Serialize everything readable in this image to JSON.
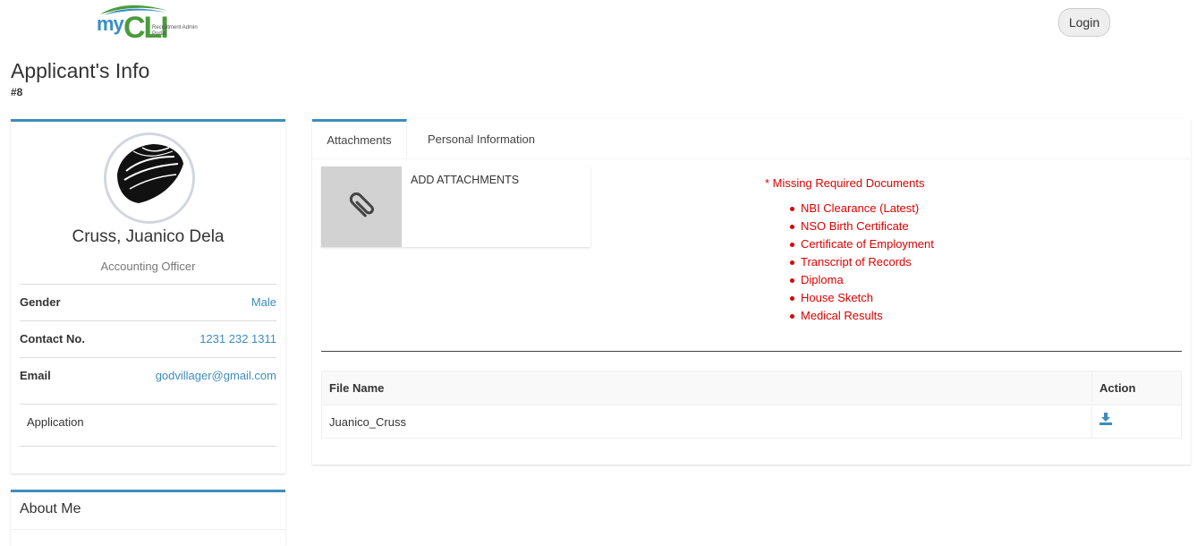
{
  "header": {
    "logo_my": "my",
    "logo_cli": "CLI",
    "logo_subtitle": "Recruitment Admin Portal",
    "login_label": "Login"
  },
  "page": {
    "title": "Applicant's Info",
    "subtitle": "#8"
  },
  "profile": {
    "name": "Cruss, Juanico Dela",
    "position": "Accounting Officer",
    "fields": [
      {
        "label": "Gender",
        "value": "Male"
      },
      {
        "label": "Contact No.",
        "value": "1231 232 1311"
      },
      {
        "label": "Email",
        "value": "godvillager@gmail.com"
      }
    ],
    "application_label": "Application"
  },
  "about": {
    "title": "About Me"
  },
  "tabs": [
    {
      "label": "Attachments",
      "active": true
    },
    {
      "label": "Personal Information",
      "active": false
    }
  ],
  "attachments": {
    "add_label": "ADD ATTACHMENTS",
    "missing_title": "* Missing Required Documents",
    "missing_items": [
      "NBI Clearance (Latest)",
      "NSO Birth Certificate",
      "Certificate of Employment",
      "Transcript of Records",
      "Diploma",
      "House Sketch",
      "Medical Results"
    ],
    "table": {
      "headers": [
        "File Name",
        "Action"
      ],
      "rows": [
        {
          "file_name": "Juanico_Cruss",
          "action_icon": "download-icon"
        }
      ]
    }
  },
  "colors": {
    "accent": "#3c8dbc",
    "missing_red": "#dd0000",
    "logo_blue": "#3a8fc7",
    "logo_green": "#4b9b3d"
  }
}
